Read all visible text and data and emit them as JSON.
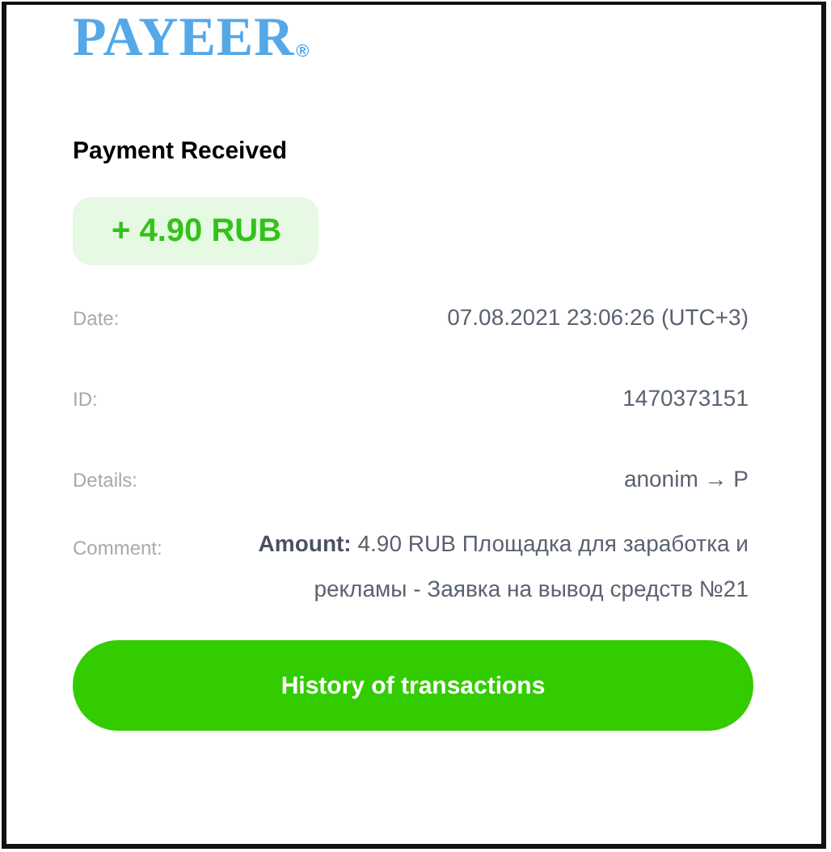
{
  "logo": {
    "name": "PAYEER",
    "mark": "®"
  },
  "heading": "Payment Received",
  "amount_badge": "+ 4.90 RUB",
  "details": [
    {
      "kind": "text",
      "label": "Date:",
      "value": "07.08.2021 23:06:26 (UTC+3)"
    },
    {
      "kind": "text",
      "label": "ID:",
      "value": "1470373151"
    },
    {
      "kind": "text",
      "label": "Details:",
      "value": "anonim → P"
    },
    {
      "kind": "comment",
      "label": "Comment:",
      "value": "**Amount:** 4.90 RUB Площадка для заработка и рекламы - Заявка на вывод средств №21"
    }
  ],
  "button": "History of transactions"
}
